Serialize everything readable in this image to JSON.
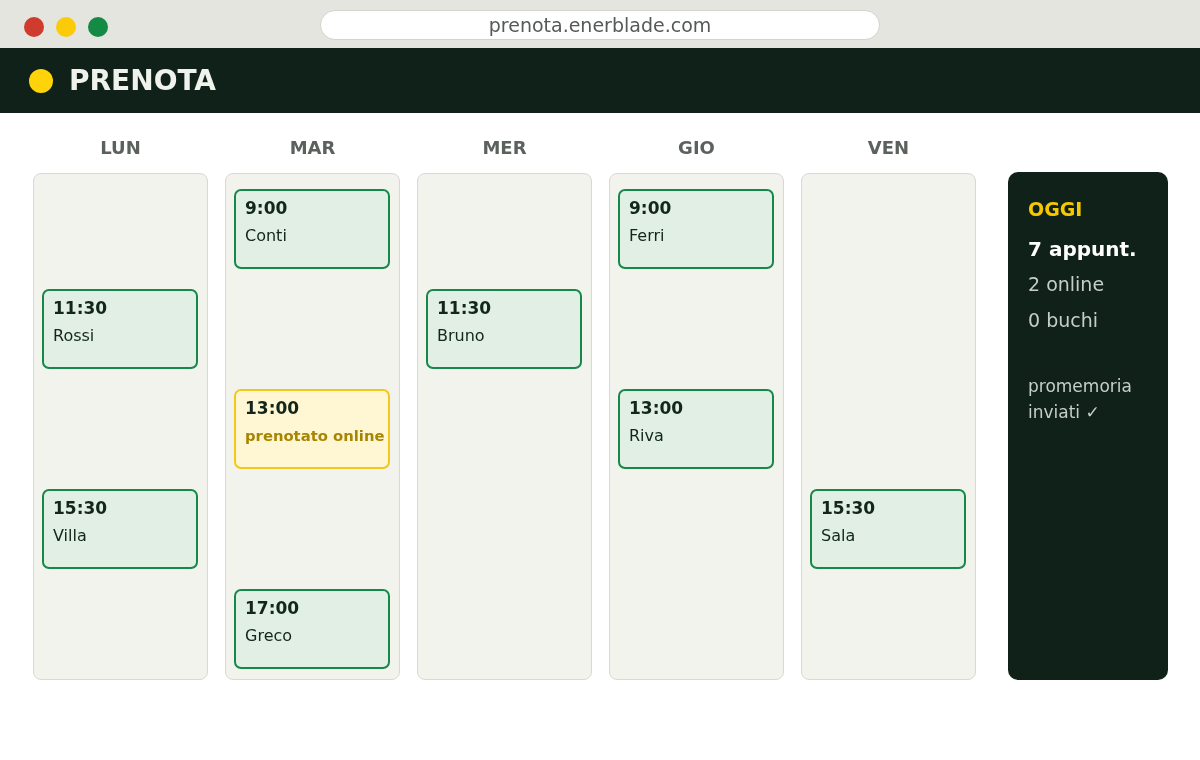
{
  "browser": {
    "url": "prenota.enerblade.com"
  },
  "app": {
    "title": "PRENOTA"
  },
  "days": [
    {
      "label": "LUN",
      "slots": [
        {
          "kind": "free"
        },
        {
          "kind": "booked",
          "time": "11:30",
          "text": "Rossi"
        },
        {
          "kind": "free"
        },
        {
          "kind": "booked",
          "time": "15:30",
          "text": "Villa"
        },
        {
          "kind": "free"
        }
      ]
    },
    {
      "label": "MAR",
      "slots": [
        {
          "kind": "booked",
          "time": "9:00",
          "text": "Conti"
        },
        {
          "kind": "free"
        },
        {
          "kind": "online",
          "time": "13:00",
          "text": "prenotato online"
        },
        {
          "kind": "free"
        },
        {
          "kind": "booked",
          "time": "17:00",
          "text": "Greco"
        }
      ]
    },
    {
      "label": "MER",
      "slots": [
        {
          "kind": "free"
        },
        {
          "kind": "booked",
          "time": "11:30",
          "text": "Bruno"
        },
        {
          "kind": "free"
        },
        {
          "kind": "free"
        },
        {
          "kind": "free"
        }
      ]
    },
    {
      "label": "GIO",
      "slots": [
        {
          "kind": "booked",
          "time": "9:00",
          "text": "Ferri"
        },
        {
          "kind": "free"
        },
        {
          "kind": "booked",
          "time": "13:00",
          "text": "Riva"
        },
        {
          "kind": "free"
        },
        {
          "kind": "free"
        }
      ]
    },
    {
      "label": "VEN",
      "slots": [
        {
          "kind": "free"
        },
        {
          "kind": "free"
        },
        {
          "kind": "free"
        },
        {
          "kind": "booked",
          "time": "15:30",
          "text": "Sala"
        },
        {
          "kind": "free"
        }
      ]
    }
  ],
  "summary": {
    "title": "OGGI",
    "total": "7 appunt.",
    "online": "2 online",
    "gaps": "0 buchi",
    "note": "promemoria inviati ✓"
  }
}
